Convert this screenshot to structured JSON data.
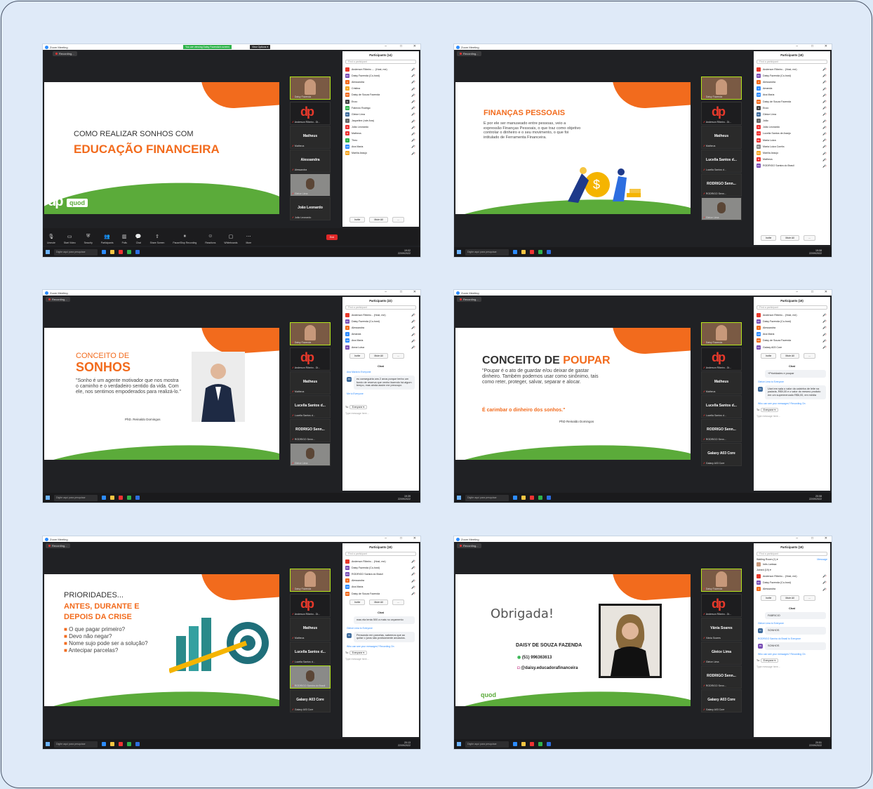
{
  "common": {
    "app_title": "Zoom Meeting",
    "recording": "Recording...",
    "find_participant": "Find a participant",
    "invite": "Invite",
    "mute_all": "Mute All",
    "more_dots": "...",
    "chat_title": "Chat",
    "to_label": "To:",
    "everyone": "Everyone ▾",
    "type_message": "Type message here...",
    "who_can_see": "Who can see your messages? Recording On",
    "search_taskbar": "Digite aqui para pesquisar",
    "date": "22/09/2022",
    "lang": "POR PTB2"
  },
  "shot1": {
    "sharing_banner": "You are viewing Daisy Fazenda's screen",
    "view_options": "View Options ▾",
    "participants_title": "Participants (14)",
    "slide_line1": "COMO REALIZAR SONHOS COM",
    "slide_line2": "EDUCAÇÃO FINANCEIRA",
    "brand": "quod",
    "time": "19:02",
    "participants": [
      {
        "name": "Anderson Ribeiro -... (Host, me)",
        "init": "",
        "color": "#e8392b"
      },
      {
        "name": "Daisy Fazenda (Co-host)",
        "init": "DF",
        "color": "#7a4fb5"
      },
      {
        "name": "Alessandra",
        "init": "A",
        "color": "#f26b1d"
      },
      {
        "name": "Cristina",
        "init": "C",
        "color": "#f5a623"
      },
      {
        "name": "Daisy de Souza Fazenda",
        "init": "DD",
        "color": "#f26b1d"
      },
      {
        "name": "Enzo",
        "init": "E",
        "color": "#444"
      },
      {
        "name": "Fabrício Rodrigo",
        "init": "FR",
        "color": "#2fb24b"
      },
      {
        "name": "Gleice Lima",
        "init": "GL",
        "color": "#3e6b9c"
      },
      {
        "name": "Jaqueline (nde Ana)",
        "init": "J",
        "color": "#666"
      },
      {
        "name": "João Leonardo",
        "init": "JL",
        "color": "#e33"
      },
      {
        "name": "Matheus",
        "init": "M",
        "color": "#e33"
      },
      {
        "name": "Theo",
        "init": "T",
        "color": "#2fb24b"
      },
      {
        "name": "Ana Maria",
        "init": "AM",
        "color": "#2d8cff"
      },
      {
        "name": "Marília Araujo",
        "init": "MA",
        "color": "#f5a623"
      }
    ],
    "tiles": [
      "Daisy Fazenda",
      "Anderson Ribeiro - Di...",
      "Matheus",
      "Alessandra",
      "Gleice Lima",
      "João Leonardo"
    ],
    "toolbar": [
      "Unmute",
      "Start Video",
      "Security",
      "Participants",
      "Polls",
      "Chat",
      "Share Screen",
      "Pause/Stop Recording",
      "Reactions",
      "Whiteboards",
      "More"
    ],
    "end": "End"
  },
  "shot2": {
    "participants_title": "Participants (18)",
    "slide_title": "FINANÇAS PESSOAIS",
    "slide_text": "E por ele ser manuseado entre pessoas, veio a expressão Finanças Pessoais, o que traz como objetivo controlar o dinheiro e o seu movimento, o que foi intitulado de Ferramenta Financeira.",
    "time": "19:08",
    "participants": [
      {
        "name": "Anderson Ribeiro... (Host, me)",
        "init": "",
        "color": "#e8392b"
      },
      {
        "name": "Daisy Fazenda (Co-host)",
        "init": "DF",
        "color": "#7a4fb5"
      },
      {
        "name": "Alessandra",
        "init": "A",
        "color": "#f26b1d"
      },
      {
        "name": "Amanda",
        "init": "A",
        "color": "#2d8cff"
      },
      {
        "name": "Ana Maria",
        "init": "AM",
        "color": "#2d8cff"
      },
      {
        "name": "Daisy de Souza Fazenda",
        "init": "DD",
        "color": "#f26b1d"
      },
      {
        "name": "Enzo",
        "init": "E",
        "color": "#444"
      },
      {
        "name": "Gleice Lima",
        "init": "GL",
        "color": "#3e6b9c"
      },
      {
        "name": "João",
        "init": "J",
        "color": "#666"
      },
      {
        "name": "João Leonardo",
        "init": "JL",
        "color": "#e33"
      },
      {
        "name": "Lucella Santos de Araújo",
        "init": "LS",
        "color": "#e33"
      },
      {
        "name": "Maria Luiza",
        "init": "ML",
        "color": "#e33"
      },
      {
        "name": "Maria Luiza Corrêa",
        "init": "ML",
        "color": "#888"
      },
      {
        "name": "Marília Araujo",
        "init": "MA",
        "color": "#f5a623"
      },
      {
        "name": "Matheus",
        "init": "M",
        "color": "#e33"
      },
      {
        "name": "RODRIGO Samira do Brasil",
        "init": "RS",
        "color": "#7a4fb5"
      }
    ],
    "tiles": [
      "Daisy Fazenda",
      "Anderson Ribeiro - Di...",
      "Matheus",
      "Lucella Santos d...",
      "RODRIGO Senn...",
      "Gleice Lima"
    ]
  },
  "shot3": {
    "participants_title": "Participants (22)",
    "slide_title1": "CONCEITO DE",
    "slide_title2": "SONHOS",
    "slide_text": "\"Sonho é um agente motivador que nos mostra o caminho e o verdadeiro sentido da vida. Com ele, nos sentimos empoderados para realizá-lo.\"",
    "author": "PhD. Reinaldo Domingos",
    "time": "19:39",
    "participants": [
      {
        "name": "Anderson Ribeiro... (Host, me)",
        "init": "",
        "color": "#e8392b"
      },
      {
        "name": "Daisy Fazenda (Co-host)",
        "init": "DF",
        "color": "#7a4fb5"
      },
      {
        "name": "Alessandra",
        "init": "A",
        "color": "#f26b1d"
      },
      {
        "name": "Amanda",
        "init": "A",
        "color": "#2d8cff"
      },
      {
        "name": "Ana Maria",
        "init": "AM",
        "color": "#2d8cff"
      },
      {
        "name": "Anna Luisa",
        "init": "AL",
        "color": "#7a4fb5"
      }
    ],
    "chat": [
      {
        "from": "Ana Maria to Everyone",
        "init": "AM",
        "text": "eu conseguiria uns 2 anos porque tenho um fundo de reserva que venho fazendo há algum tempo, mas ainda assim me preocupo"
      },
      {
        "from": "Me to Everyone",
        "init": "",
        "text": ""
      }
    ],
    "tiles": [
      "Daisy Fazenda",
      "Anderson Ribeiro - Di...",
      "Matheus",
      "Lucella Santos d...",
      "RODRIGO Senn...",
      "Gleice Lima"
    ]
  },
  "shot4": {
    "participants_title": "Participants (19)",
    "slide_title1": "CONCEITO DE ",
    "slide_title2": "POUPAR",
    "slide_text": "\"Poupar é o ato de guardar e/ou deixar de gastar dinheiro. Também podemos usar como sinônimo, tais como reter, proteger, salvar, separar e alocar.",
    "slide_text2": "É carimbar o dinheiro dos sonhos.\"",
    "author": "PhD Reinaldo Domingos",
    "time": "20:08",
    "participants": [
      {
        "name": "Anderson Ribeiro... (Host, me)",
        "init": "",
        "color": "#e8392b"
      },
      {
        "name": "Daisy Fazenda (Co-host)",
        "init": "DF",
        "color": "#7a4fb5"
      },
      {
        "name": "Alessandra",
        "init": "A",
        "color": "#f26b1d"
      },
      {
        "name": "Ana Maria",
        "init": "AM",
        "color": "#2d8cff"
      },
      {
        "name": "Daisy de Souza Fazenda",
        "init": "DD",
        "color": "#f26b1d"
      },
      {
        "name": "Galaxy A03 Core",
        "init": "GA",
        "color": "#7a4fb5"
      }
    ],
    "chat": [
      {
        "from": "",
        "init": "",
        "text": "+Prioridades e poupar"
      },
      {
        "from": "Gleice Lima to Everyone",
        "init": "GL",
        "text": "Usei em sala o valor da caixinha de leite na padaria, R$9,00 e o valor do mesmo produto em um supermercado R$6,00, em média"
      }
    ],
    "tiles": [
      "Daisy Fazenda",
      "Anderson Ribeiro - Di...",
      "Matheus",
      "Lucella Santos d...",
      "RODRIGO Senn...",
      "Galaxy A03 Core"
    ]
  },
  "shot5": {
    "participants_title": "Participants (19)",
    "slide_title": "PRIORIDADES...",
    "slide_title2": "ANTES, DURANTE E",
    "slide_title3": "DEPOIS DA CRISE",
    "bullets": [
      "O que pagar primeiro?",
      "Devo não negar?",
      "Nome sujo pode ser a solução?",
      "Antecipar parcelas?"
    ],
    "time": "20:13",
    "participants": [
      {
        "name": "Anderson Ribeiro... (Host, me)",
        "init": "",
        "color": "#e8392b"
      },
      {
        "name": "Daisy Fazenda (Co-host)",
        "init": "DF",
        "color": "#7a4fb5"
      },
      {
        "name": "RODRIGO Samira do Brasil",
        "init": "RS",
        "color": "#7a4fb5"
      },
      {
        "name": "Alessandra",
        "init": "A",
        "color": "#f26b1d"
      },
      {
        "name": "Ana Maria",
        "init": "AM",
        "color": "#2d8cff"
      },
      {
        "name": "Daisy de Souza Fazenda",
        "init": "DD",
        "color": "#f26b1d"
      }
    ],
    "chat": [
      {
        "from": "",
        "init": "",
        "text": "mas ela tenta 500 a mais no orçamento"
      },
      {
        "from": "Gleice Lima to Everyone",
        "init": "GL",
        "text": "Pensando em parcelas, sabemos que ao quitar o juros são praticamente anulados."
      }
    ],
    "tiles": [
      "Daisy Fazenda",
      "Anderson Ribeiro - Di...",
      "Matheus",
      "Lucella Santos d...",
      "RODRIGO Samira do Brasil",
      "Galaxy A03 Core"
    ]
  },
  "shot6": {
    "participants_title": "Participants (19)",
    "slide_title": "Obrigada!",
    "name": "DAISY DE SOUZA FAZENDA",
    "phone": "(51) 996363613",
    "insta": "@daisy.educadorafinanceira",
    "waiting": "Waiting Room (1) ▾",
    "message": "Message",
    "waiting_name": "Inês Larissa",
    "joined": "Joined (19) ▾",
    "time": "20:51",
    "participants": [
      {
        "name": "Anderson Ribeiro... (Host, me)",
        "init": "",
        "color": "#e8392b"
      },
      {
        "name": "Daisy Fazenda (Co-host)",
        "init": "DF",
        "color": "#7a4fb5"
      },
      {
        "name": "Alessandra",
        "init": "A",
        "color": "#f26b1d"
      }
    ],
    "chat": [
      {
        "from": "",
        "init": "",
        "text": "FABRICIO"
      },
      {
        "from": "Gleice Lima to Everyone",
        "init": "GL",
        "text": "SONHOS"
      },
      {
        "from": "RODRIGO Samira do Brasil to Everyone",
        "init": "RS",
        "text": "SONHOS"
      }
    ],
    "tiles": [
      "Daisy Fazenda",
      "Anderson Ribeiro - Di...",
      "Vânia Soares",
      "Gleice Lima",
      "RODRIGO Senn...",
      "Galaxy A03 Core"
    ]
  }
}
